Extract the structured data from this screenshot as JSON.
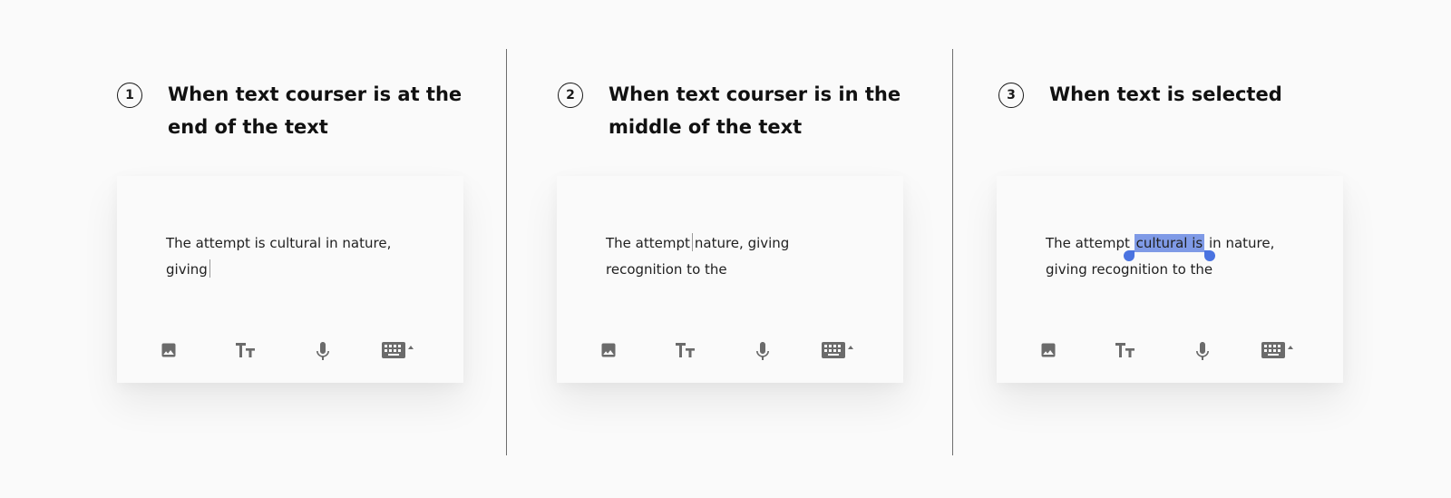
{
  "panels": [
    {
      "number": "1",
      "heading_line1": "When text courser is at the",
      "heading_line2": "end of the text",
      "text_line1": "The attempt is cultural in nature,",
      "text_line2": "giving"
    },
    {
      "number": "2",
      "heading_line1": "When text courser is in the",
      "heading_line2": "middle of the text",
      "text_line1_before": "The attempt",
      "text_line1_after": "nature, giving",
      "text_line2": "recognition to the"
    },
    {
      "number": "3",
      "heading_line1": "When text is selected",
      "text_line1_before": "The attempt ",
      "text_selected": "cultural is",
      "text_line1_after": " in nature,",
      "text_line2": "giving recognition to the"
    }
  ],
  "toolbar_icons": [
    "image-icon",
    "text-size-icon",
    "microphone-icon",
    "keyboard-icon"
  ],
  "colors": {
    "background": "#fafafa",
    "selection": "#7f9ae6",
    "selection_handle": "#4a73e0",
    "icon": "#6b6b6b",
    "divider": "#6e6e6e"
  }
}
